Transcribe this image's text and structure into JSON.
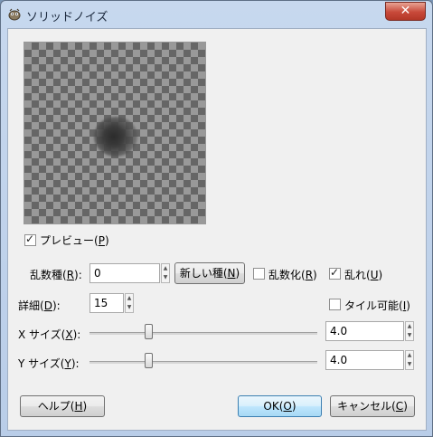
{
  "window": {
    "title": "ソリッドノイズ",
    "close_glyph": "✕"
  },
  "preview": {
    "label": "プレビュー(",
    "key": "P",
    "close": ")",
    "checked": true
  },
  "seed": {
    "label": "乱数種(",
    "key": "R",
    "close": "):",
    "value": "0"
  },
  "new_seed_button": {
    "label": "新しい種(",
    "key": "N",
    "close": ")"
  },
  "randomize": {
    "label": "乱数化(",
    "key": "R",
    "close": ")",
    "checked": false
  },
  "turbulent": {
    "label": "乱れ(",
    "key": "U",
    "close": ")",
    "checked": true
  },
  "detail": {
    "label": "詳細(",
    "key": "D",
    "close": "):",
    "value": "15"
  },
  "tileable": {
    "label": "タイル可能(",
    "key": "I",
    "close": ")",
    "checked": false
  },
  "x_size": {
    "label": "X サイズ(",
    "key": "X",
    "close": "):",
    "value": "4.0",
    "fraction": 0.25
  },
  "y_size": {
    "label": "Y サイズ(",
    "key": "Y",
    "close": "):",
    "value": "4.0",
    "fraction": 0.25
  },
  "help_button": {
    "label": "ヘルプ(",
    "key": "H",
    "close": ")"
  },
  "ok_button": {
    "label": "OK(",
    "key": "O",
    "close": ")"
  },
  "cancel_button": {
    "label": "キャンセル(",
    "key": "C",
    "close": ")"
  }
}
